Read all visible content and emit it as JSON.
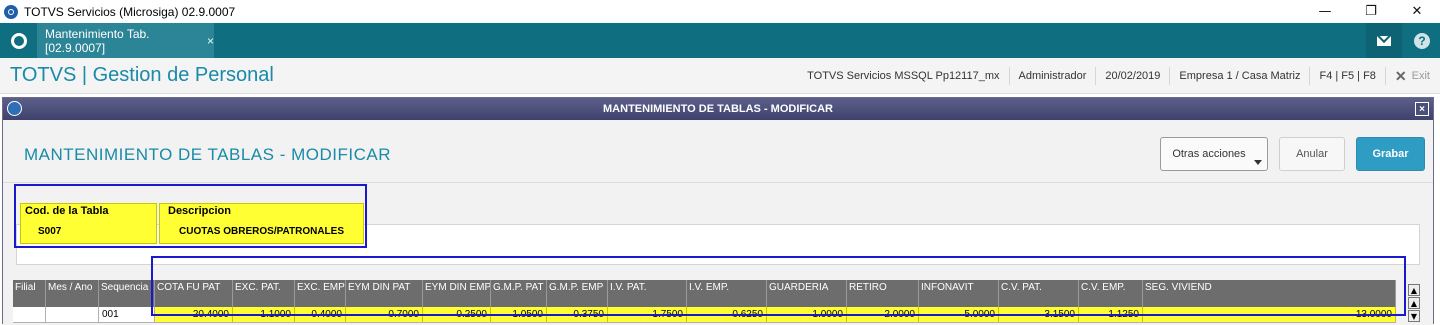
{
  "window": {
    "title": "TOTVS Servicios (Microsiga) 02.9.0007",
    "controls": {
      "minimize": "—",
      "restore": "❐",
      "close": "✕"
    }
  },
  "tabbar": {
    "tab_label": "Mantenimiento Tab. [02.9.0007]",
    "tab_close": "×",
    "help": "?"
  },
  "header": {
    "module_title": "TOTVS | Gestion de Personal",
    "environment": "TOTVS Servicios MSSQL Pp12117_mx",
    "user": "Administrador",
    "date": "20/02/2019",
    "company": "Empresa 1 / Casa Matriz",
    "function_keys": "F4 | F5 | F8",
    "exit_label": "Exit",
    "exit_icon": "✕"
  },
  "dialog": {
    "titlebar": "MANTENIMIENTO DE TABLAS - MODIFICAR",
    "close": "×",
    "heading": "MANTENIMIENTO DE TABLAS - MODIFICAR",
    "buttons": {
      "otras": "Otras acciones",
      "anular": "Anular",
      "grabar": "Grabar"
    },
    "fields": {
      "cod_label": "Cod. de la Tabla",
      "cod_value": "S007",
      "desc_label": "Descripcion",
      "desc_value": "CUOTAS OBREROS/PATRONALES"
    }
  },
  "grid": {
    "columns": [
      "Filial",
      "Mes / Ano",
      "Sequencia",
      "COTA FU PAT",
      "EXC. PAT.",
      "EXC. EMP",
      "EYM DIN PAT",
      "EYM DIN EMP",
      "G.M.P. PAT",
      "G.M.P. EMP",
      "I.V. PAT.",
      "I.V. EMP.",
      "GUARDERIA",
      "RETIRO",
      "INFONAVIT",
      "C.V. PAT.",
      "C.V. EMP.",
      "SEG. VIVIEND"
    ],
    "row": [
      "",
      "",
      "001",
      "20.4000",
      "1.1000",
      "0.4000",
      "0.7000",
      "0.2500",
      "1.0500",
      "0.3750",
      "1.7500",
      "0.6250",
      "1.0000",
      "2.0000",
      "5.0000",
      "3.1500",
      "1.1250",
      "13.0000"
    ],
    "scroll": {
      "top": "▲",
      "up": "▲",
      "down": "▼"
    }
  },
  "colors": {
    "teal_bar": "#0f6e80",
    "brand_text": "#1a8aa8",
    "highlight_yellow": "#ffff33",
    "highlight_border": "#1a1acc",
    "grabar_button": "#2e9cc3"
  }
}
